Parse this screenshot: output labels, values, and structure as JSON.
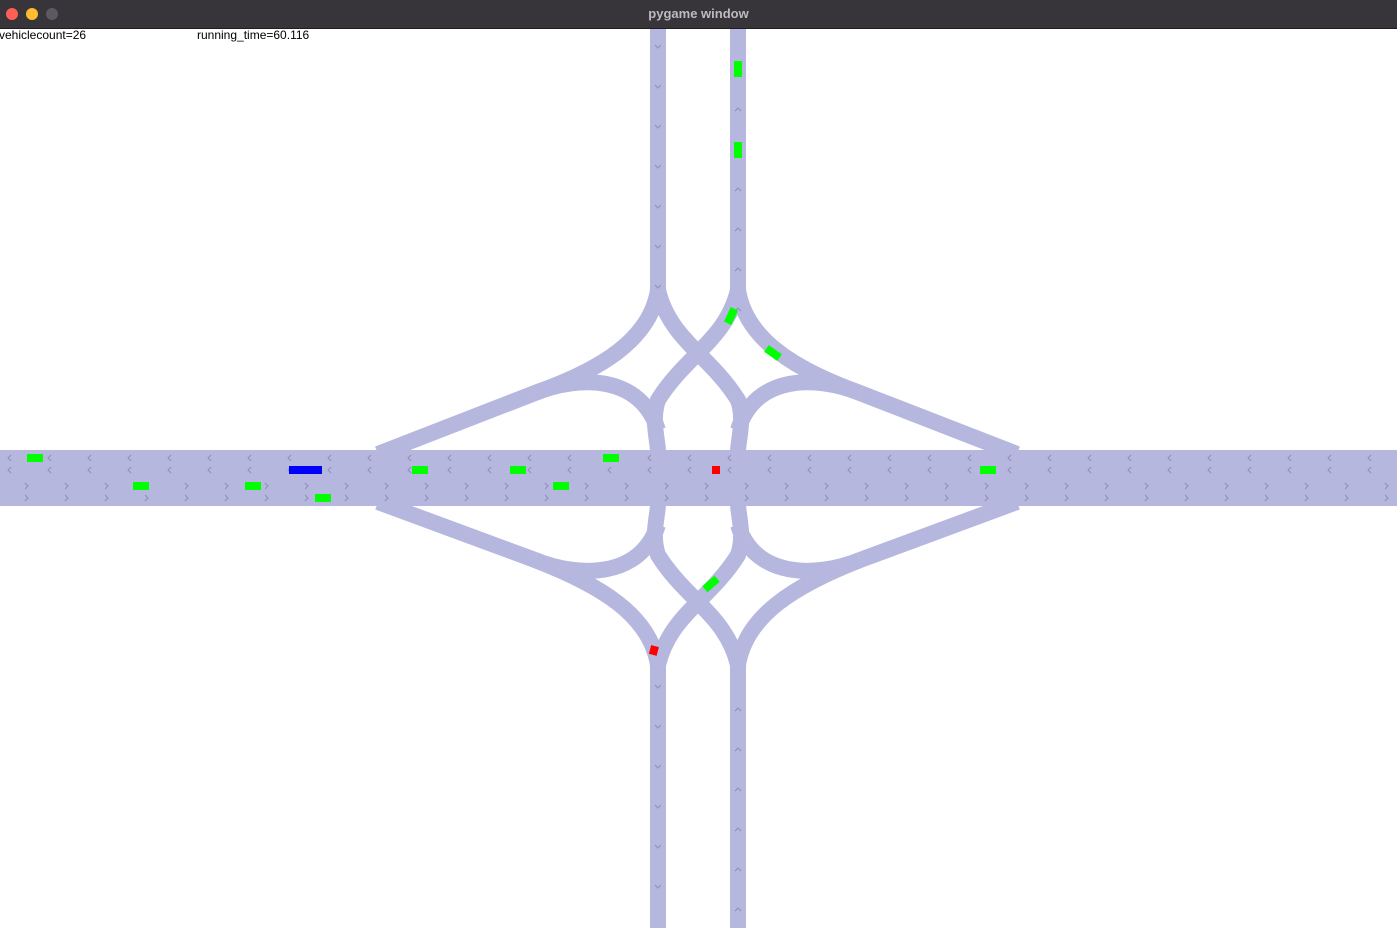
{
  "window": {
    "title": "pygame window",
    "buttons": [
      "close",
      "minimize",
      "maximize"
    ]
  },
  "hud": {
    "vehicle_count_label": "vehiclecount=26",
    "running_time_label": "running_time=60.116"
  },
  "colors": {
    "road": "#b5b7de",
    "road_arrow": "#8d8fb8",
    "vehicle_green": "#00ff00",
    "vehicle_blue": "#0000ff",
    "vehicle_red": "#ff0000",
    "background": "#ffffff"
  },
  "vehicles": [
    {
      "id": "v1",
      "color": "green"
    },
    {
      "id": "v2",
      "color": "green"
    },
    {
      "id": "v3",
      "color": "green"
    },
    {
      "id": "v4",
      "color": "green"
    },
    {
      "id": "v5",
      "color": "blue"
    },
    {
      "id": "v6",
      "color": "green"
    },
    {
      "id": "v7",
      "color": "green"
    },
    {
      "id": "v8",
      "color": "green"
    },
    {
      "id": "v9",
      "color": "green"
    },
    {
      "id": "v10",
      "color": "green"
    },
    {
      "id": "v11",
      "color": "red"
    },
    {
      "id": "v12",
      "color": "green"
    },
    {
      "id": "v13",
      "color": "green"
    },
    {
      "id": "v14",
      "color": "green"
    },
    {
      "id": "v15",
      "color": "green"
    },
    {
      "id": "v16",
      "color": "green"
    },
    {
      "id": "v17",
      "color": "green"
    },
    {
      "id": "v18",
      "color": "red"
    }
  ]
}
